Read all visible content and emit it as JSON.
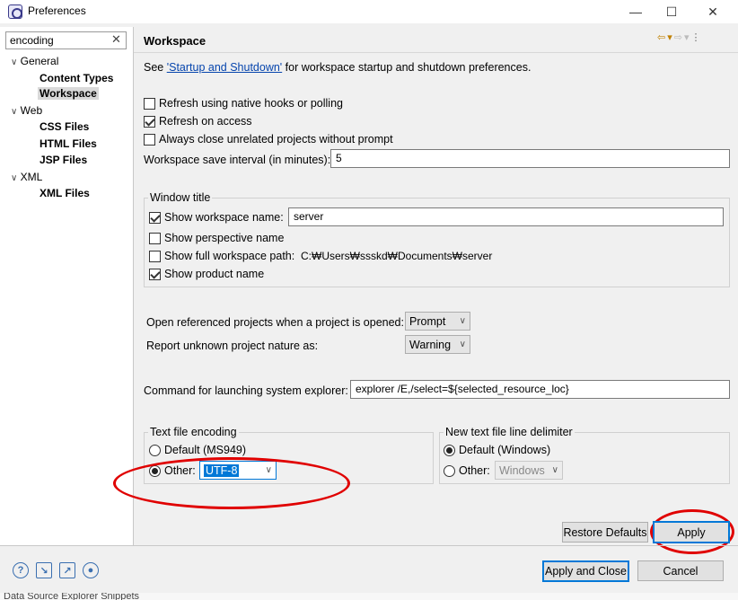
{
  "window": {
    "title": "Preferences",
    "minimize": "—",
    "maximize": "☐",
    "close": "✕"
  },
  "filter": {
    "value": "encoding",
    "clear": "✕"
  },
  "tree": {
    "general": "General",
    "content_types": "Content Types",
    "workspace": "Workspace",
    "web": "Web",
    "css_files": "CSS Files",
    "html_files": "HTML Files",
    "jsp_files": "JSP Files",
    "xml": "XML",
    "xml_files": "XML Files"
  },
  "page": {
    "title": "Workspace",
    "see_prefix": "See ",
    "see_link": "'Startup and Shutdown'",
    "see_suffix": " for workspace startup and shutdown preferences.",
    "refresh_native": "Refresh using native hooks or polling",
    "refresh_native_checked": false,
    "refresh_access": "Refresh on access",
    "refresh_access_checked": true,
    "always_close": "Always close unrelated projects without prompt",
    "always_close_checked": false,
    "save_interval_label": "Workspace save interval (in minutes):",
    "save_interval_value": "5"
  },
  "window_title_group": {
    "label": "Window title",
    "show_ws_name": "Show workspace name:",
    "show_ws_name_checked": true,
    "ws_name_value": "server",
    "show_perspective": "Show perspective name",
    "show_perspective_checked": false,
    "show_full_path": "Show full workspace path:",
    "show_full_path_checked": false,
    "full_path_value": "C:₩Users₩ssskd₩Documents₩server",
    "show_product": "Show product name",
    "show_product_checked": true
  },
  "projects": {
    "open_ref_label": "Open referenced projects when a project is opened:",
    "open_ref_value": "Prompt",
    "unknown_nature_label": "Report unknown project nature as:",
    "unknown_nature_value": "Warning"
  },
  "explorer": {
    "label": "Command for launching system explorer:",
    "value": "explorer /E,/select=${selected_resource_loc}"
  },
  "encoding": {
    "label": "Text file encoding",
    "default_label": "Default (MS949)",
    "other_label": "Other:",
    "other_value": "UTF-8"
  },
  "delimiter": {
    "label": "New text file line delimiter",
    "default_label": "Default (Windows)",
    "other_label": "Other:",
    "other_value": "Windows"
  },
  "buttons": {
    "restore_defaults": "Restore Defaults",
    "apply": "Apply",
    "apply_close": "Apply and Close",
    "cancel": "Cancel"
  },
  "bottom_icons": [
    "help-icon",
    "import-icon",
    "export-icon",
    "record-icon"
  ],
  "status": {
    "text": "Data Source Explorer   Snippets"
  },
  "colors": {
    "link": "#0645ad",
    "selection": "#0078d7",
    "annotation": "#e00000"
  }
}
